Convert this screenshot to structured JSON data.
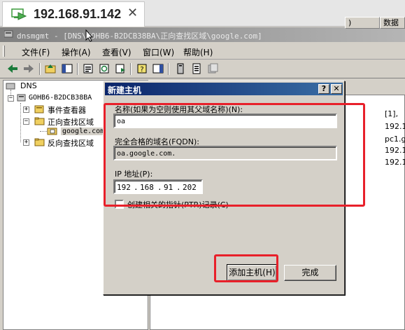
{
  "remote_tab": {
    "title": "192.168.91.142",
    "close_glyph": "✕"
  },
  "window": {
    "title": "dnsmgmt - [DNS\\GOHB6-B2DCB38BA\\正向查找区域\\google.com]"
  },
  "menu": {
    "items": [
      "文件(F)",
      "操作(A)",
      "查看(V)",
      "窗口(W)",
      "帮助(H)"
    ]
  },
  "tree": {
    "root": "DNS",
    "server": "GOHB6-B2DCB38BA",
    "event_viewer": "事件查看器",
    "forward_zones": "正向查找区域",
    "zone": "google.com",
    "reverse_zones": "反向查找区域"
  },
  "right_pane": {
    "column_data": "数据",
    "hidden_col_fragment": ")",
    "rows": [
      "[1],",
      "192.1",
      "pc1.g",
      "192.1",
      "192.1"
    ]
  },
  "dialog": {
    "title": "新建主机",
    "help_glyph": "?",
    "close_glyph": "✕",
    "name_label": "名称(如果为空则使用其父域名称)(N):",
    "name_value": "oa",
    "fqdn_label": "完全合格的域名(FQDN):",
    "fqdn_value": "oa.google.com.",
    "ip_label": "IP 地址(P):",
    "ip_segments": [
      "192",
      "168",
      "91",
      "202"
    ],
    "ptr_label": "创建相关的指针(PTR)记录(C)",
    "ptr_checked": false,
    "add_button": "添加主机(H)",
    "done_button": "完成"
  },
  "colors": {
    "highlight_red": "#e8202a",
    "dialog_title_start": "#0a246a",
    "dialog_title_end": "#3a6ea5"
  }
}
